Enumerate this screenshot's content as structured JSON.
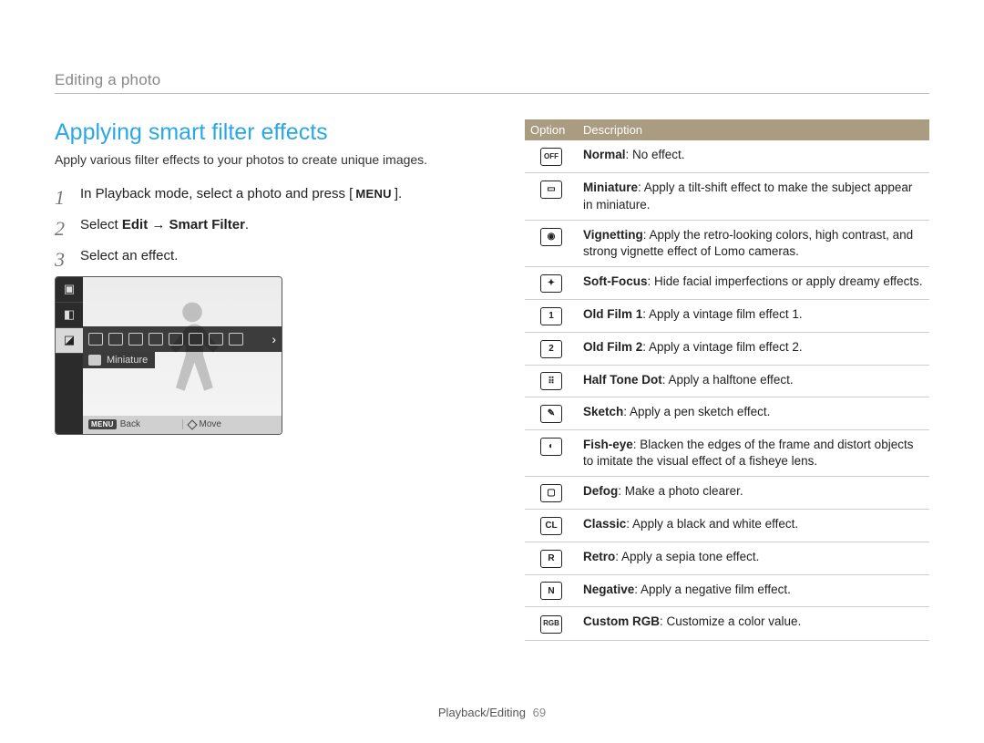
{
  "breadcrumb": "Editing a photo",
  "section_title": "Applying smart filter effects",
  "intro": "Apply various filter effects to your photos to create unique images.",
  "steps": {
    "s1_pre": "In Playback mode, select a photo and press [",
    "s1_btn": "MENU",
    "s1_post": "].",
    "s2_pre": "Select ",
    "s2_bold1": "Edit",
    "s2_arrow": " → ",
    "s2_bold2": "Smart Filter",
    "s2_post": ".",
    "s3": "Select an effect."
  },
  "screenshot": {
    "selected_label": "Miniature",
    "back_tag": "MENU",
    "back_label": "Back",
    "move_label": "Move"
  },
  "table": {
    "header_option": "Option",
    "header_desc": "Description",
    "rows": [
      {
        "icon": "OFF",
        "name": "Normal",
        "desc": ": No effect."
      },
      {
        "icon": "▭",
        "name": "Miniature",
        "desc": ": Apply a tilt-shift effect to make the subject appear in miniature."
      },
      {
        "icon": "◉",
        "name": "Vignetting",
        "desc": ": Apply the retro-looking colors, high contrast, and strong vignette effect of Lomo cameras."
      },
      {
        "icon": "✦",
        "name": "Soft-Focus",
        "desc": ": Hide facial imperfections or apply dreamy effects."
      },
      {
        "icon": "1",
        "name": "Old Film 1",
        "desc": ": Apply a vintage film effect 1."
      },
      {
        "icon": "2",
        "name": "Old Film 2",
        "desc": ": Apply a vintage film effect 2."
      },
      {
        "icon": "⠿",
        "name": "Half Tone Dot",
        "desc": ": Apply a halftone effect."
      },
      {
        "icon": "✎",
        "name": "Sketch",
        "desc": ": Apply a pen sketch effect."
      },
      {
        "icon": "◐",
        "name": "Fish-eye",
        "desc": ": Blacken the edges of the frame and distort objects to imitate the visual effect of a fisheye lens."
      },
      {
        "icon": "▢",
        "name": "Defog",
        "desc": ": Make a photo clearer."
      },
      {
        "icon": "CL",
        "name": "Classic",
        "desc": ": Apply a black and white effect."
      },
      {
        "icon": "R",
        "name": "Retro",
        "desc": ": Apply a sepia tone effect."
      },
      {
        "icon": "N",
        "name": "Negative",
        "desc": ": Apply a negative film effect."
      },
      {
        "icon": "RGB",
        "name": "Custom RGB",
        "desc": ": Customize a color value."
      }
    ]
  },
  "footer": {
    "section": "Playback/Editing",
    "page": "69"
  }
}
